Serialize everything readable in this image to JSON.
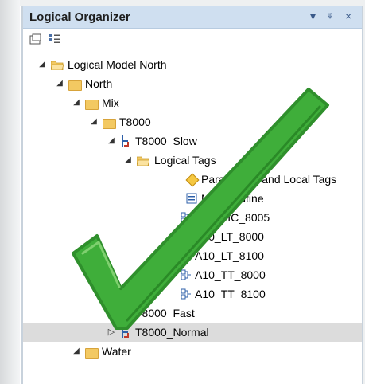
{
  "panel": {
    "title": "Logical Organizer",
    "controls": [
      "▾",
      "ᵠ",
      "×"
    ]
  },
  "toolbar": {
    "icons": [
      "new-folder-icon",
      "properties-icon"
    ]
  },
  "tree": {
    "items": [
      {
        "label": "Logical Model North"
      },
      {
        "label": "North"
      },
      {
        "label": "Mix"
      },
      {
        "label": "T8000"
      },
      {
        "label": "T8000_Slow"
      },
      {
        "label": "Logical Tags"
      },
      {
        "label": "Parameters and Local Tags"
      },
      {
        "label": "MainRoutine"
      },
      {
        "label": "A10_FIC_8005"
      },
      {
        "label": "A10_LT_8000"
      },
      {
        "label": "A10_LT_8100"
      },
      {
        "label": "A10_TT_8000"
      },
      {
        "label": "A10_TT_8100"
      },
      {
        "label": "T8000_Fast"
      },
      {
        "label": "T8000_Normal",
        "selected": true
      },
      {
        "label": "Water"
      }
    ]
  },
  "overlay": {
    "icon": "green-checkmark-icon",
    "color": "#3fae3a"
  }
}
